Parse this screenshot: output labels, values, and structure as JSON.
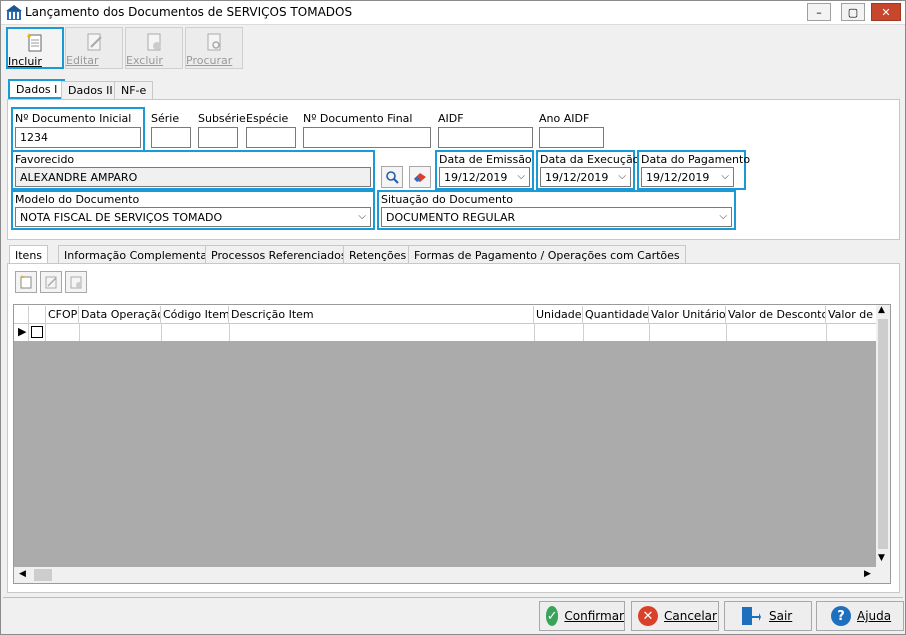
{
  "window": {
    "title": "Lançamento dos Documentos de SERVIÇOS TOMADOS",
    "minimize": "–",
    "maximize": "▢",
    "close": "✕"
  },
  "toolbar": {
    "incluir": "Incluir",
    "editar": "Editar",
    "excluir": "Excluir",
    "procurar": "Procurar"
  },
  "tabs": [
    "Dados I",
    "Dados II",
    "NF-e"
  ],
  "form": {
    "doc_inicial_label": "Nº Documento Inicial",
    "doc_inicial_value": "1234",
    "serie_label": "Série",
    "subserie_label": "Subsérie",
    "especie_label": "Espécie",
    "doc_final_label": "Nº Documento Final",
    "aidf_label": "AIDF",
    "ano_aidf_label": "Ano AIDF",
    "favorecido_label": "Favorecido",
    "favorecido_value": "ALEXANDRE AMPARO",
    "data_emissao_label": "Data de Emissão",
    "data_emissao_value": "19/12/2019",
    "data_execucao_label": "Data da Execução",
    "data_execucao_value": "19/12/2019",
    "data_pagamento_label": "Data do Pagamento",
    "data_pagamento_value": "19/12/2019",
    "modelo_label": "Modelo do Documento",
    "modelo_value": "NOTA FISCAL DE SERVIÇOS TOMADO",
    "situacao_label": "Situação do Documento",
    "situacao_value": "DOCUMENTO REGULAR"
  },
  "subtabs": [
    "Itens",
    "Informação Complementar",
    "Processos Referenciados",
    "Retenções",
    "Formas de Pagamento / Operações com Cartões"
  ],
  "grid": {
    "columns": [
      "CFOP",
      "Data Operação",
      "Código Item",
      "Descrição Item",
      "Unidade",
      "Quantidade",
      "Valor Unitário",
      "Valor de Desconto",
      "Valor de"
    ]
  },
  "footer": {
    "confirmar": "Confirmar",
    "cancelar": "Cancelar",
    "sair": "Sair",
    "ajuda": "Ajuda"
  },
  "colors": {
    "highlight": "#1a9ad6",
    "confirm": "#3aa35a",
    "cancel": "#d9412b",
    "help": "#1f6fbf"
  }
}
